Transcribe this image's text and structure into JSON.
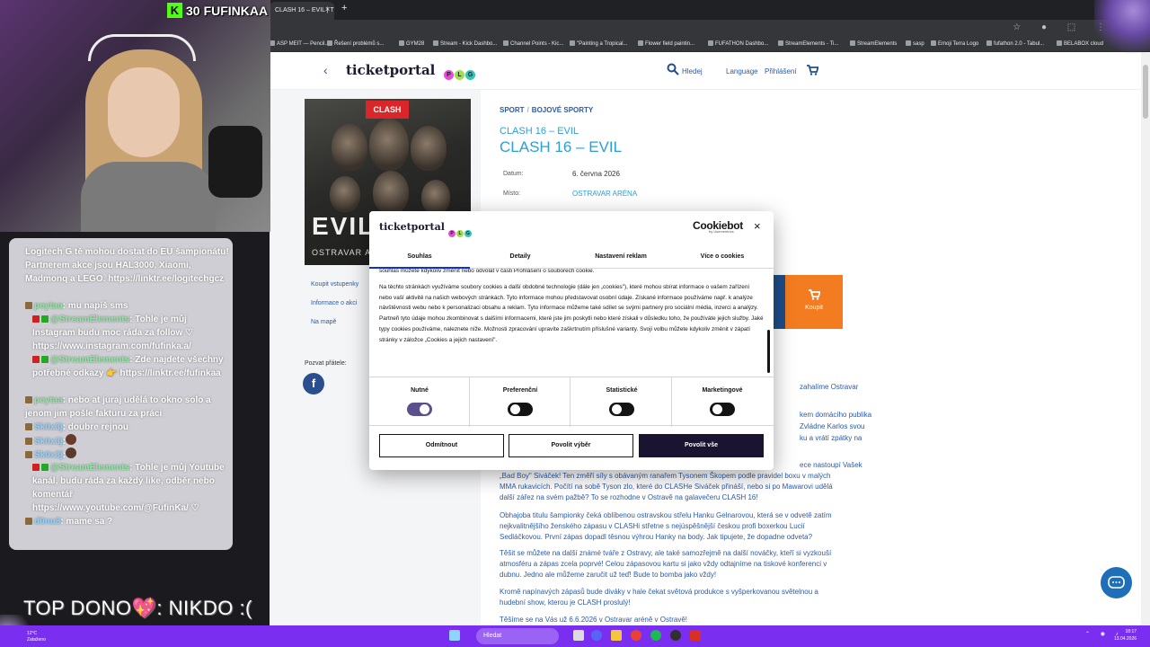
{
  "browser": {
    "tab_title": "CLASH 16 – EVIL | TICKETPORTAL",
    "tab_close": "×",
    "new_tab": "+",
    "bookmarks": [
      "ASP MEIT — Pencil...",
      "Řešení problémů s...",
      "GYM28",
      "Stream - Kick Dashbo...",
      "Channel Points - Kic...",
      "\"Painting a Tropical...",
      "Flower field paintin...",
      "FUFATHON Dashbo...",
      "StreamElements - Ti...",
      "StreamElements",
      "sasp",
      "Emoji Terra Logo",
      "fufathon 2.0 - Tabul...",
      "BELABOX cloud"
    ]
  },
  "site": {
    "back": "‹",
    "logo": "ticketportal",
    "plg": [
      "P",
      "L",
      "G"
    ],
    "plg_colors": [
      "#e84bd6",
      "#9ee04a",
      "#2fc6b4"
    ],
    "search_label": "Hledej",
    "language_label": "Language",
    "login_label": "Přihlášení",
    "sidebar_links": [
      "Koupit vstupenky",
      "Informace o akci",
      "Na mapě"
    ],
    "share_label": "Pozvat přátele:",
    "fb": "f",
    "poster": {
      "tag": "CLASH",
      "title": "EVIL",
      "sub": "OSTRAVAR ARÉNA"
    },
    "breadcrumb": [
      "SPORT",
      "BOJOVÉ SPORTY"
    ],
    "event_subtitle": "CLASH 16 – EVIL",
    "event_title": "CLASH 16 – EVIL",
    "meta": [
      {
        "label": "Datum:",
        "value": "6. června 2026"
      },
      {
        "label": "Místo:",
        "value": "OSTRAVAR ARÉNA"
      }
    ],
    "buy_label": "Koupit",
    "desc_right": [
      "zahalíme Ostravar",
      "kem domácího publika",
      "Zvládne Karlos svou",
      "ku a vrátí zpátky na"
    ],
    "desc": [
      "ece nastoupí Vašek",
      "„Bad Boy\" Siváček! Ten změří síly s obávaným ranařem Tysonem Škopem podle pravidel boxu v malých MMA rukavicích. Počítí na sobě Tyson zlo, které do CLASHe Siváček přináší, nebo si po Mawarovi udělá další zářez na svém pažbě? To se rozhodne v Ostravě na galavečeru CLASH 16!",
      "Obhajoba titulu šampionky čeká oblíbenou ostravskou střelu Hanku Gelnarovou, která se v odvetě zatím nejkvalitnějšího ženského zápasu v CLASHi střetne s nejúspěšnější českou profi boxerkou Lucií Sedláčkovou. První zápas dopadl těsnou výhrou Hanky na body. Jak tipujete, že dopadne odveta?",
      "Těšit se můžete na další známé tváře z Ostravy, ale také samozřejmě na další nováčky, kteří si vyzkouší atmosféru a zápas zcela poprvé! Celou zápasovou kartu si jako vždy odtajníme na tiskové konferenci v dubnu. Jedno ale můžeme zaručit už teď! Bude to bomba jako vždy!",
      "Kromě napínavých zápasů bude diváky v hale čekat světová produkce s vyšperkovanou světelnou a hudební show, kterou je CLASH proslulý!",
      "Těšíme se na Vás už 6.6.2026 v Ostravar aréně v Ostravě!"
    ]
  },
  "cookie": {
    "logo": "ticketportal",
    "cookiebot": "Cookiebot",
    "cookiebot_by": "by Usercentrics",
    "close": "×",
    "tabs": [
      "Souhlas",
      "Detaily",
      "Nastavení reklam",
      "Více o cookies"
    ],
    "body": [
      "souhlas můžete kdykoliv změnit nebo odvolat v části Prohlášení o souborech cookie.",
      "Na těchto stránkách využíváme soubory cookies a další obdobné technologie (dále jen „cookies\"), které mohou sbírat informace o vašem zařízení nebo vaší aktivitě na našich webových stránkách. Tyto informace mohou představovat osobní údaje. Získané informace používáme např. k analýze návštěvnosti webu nebo k personalizaci obsahu a reklam. Tyto informace můžeme také sdílet se svými partnery pro sociální média, inzerci a analýzy. Partneři tyto údaje mohou zkombinovat s dalšími informacemi, které jste jim poskytli nebo které získali v důsledku toho, že používáte jejich služby. Jaké typy cookies používáme, naleznete níže. Možnosti zpracování upravíte zaškrtnutím příslušné varianty. Svoji volbu můžete kdykoliv změnit v zápatí stránky v záložce „Cookies a jejich nastavení\"."
    ],
    "categories": [
      {
        "label": "Nutné",
        "on": true
      },
      {
        "label": "Preferenční",
        "on": false
      },
      {
        "label": "Statistické",
        "on": false
      },
      {
        "label": "Marketingové",
        "on": false
      }
    ],
    "btn_reject": "Odmítnout",
    "btn_selection": "Povolit výběr",
    "btn_all": "Povolit vše"
  },
  "stream": {
    "kick_icon": "K",
    "kick_count": "30",
    "kick_name": "FUFINKAA",
    "chat": [
      {
        "name": "",
        "text": "Logitech G tě mohou dostat do EU šampionátu! Partnerem akce jsou HAL3000, Xiaomi, Madmonq a LEGO. https://linktr.ee/logitechgcz"
      },
      {
        "name": "peytaa",
        "text": ": mu napíš sms"
      },
      {
        "name": "@StreamElements",
        "text": ": Tohle je můj Instagram budu moc ráda za follow ♡ https://www.instagram.com/fufinka.a/"
      },
      {
        "name": "@StreamElements",
        "text": ": Zde najdete všechny potřebné odkazy 👉 https://linktr.ee/fufinkaa"
      },
      {
        "name": "peytaa",
        "text": ": nebo at juraj udělá to okno solo a jenom jim pošle fakturu za práci"
      },
      {
        "name": "Sk0x3j",
        "text": ": doubre rejnou"
      },
      {
        "name": "Sk0x3j",
        "text": ":"
      },
      {
        "name": "Sk0x3j",
        "text": ":"
      },
      {
        "name": "@StreamElements",
        "text": ": Tohle je můj Youtube kanál, budu ráda za každý like, odběr nebo komentář https://www.youtube.com/@FufinKa/ ♡"
      },
      {
        "name": "d0nu3",
        "text": ": mame sa ?"
      }
    ],
    "top_dono": "TOP DONO💖: NIKDO :("
  },
  "taskbar": {
    "search": "Hledat",
    "left_line1": "12°C",
    "left_line2": "Zataženo",
    "time": "18:17",
    "date": "13.04.2026"
  }
}
